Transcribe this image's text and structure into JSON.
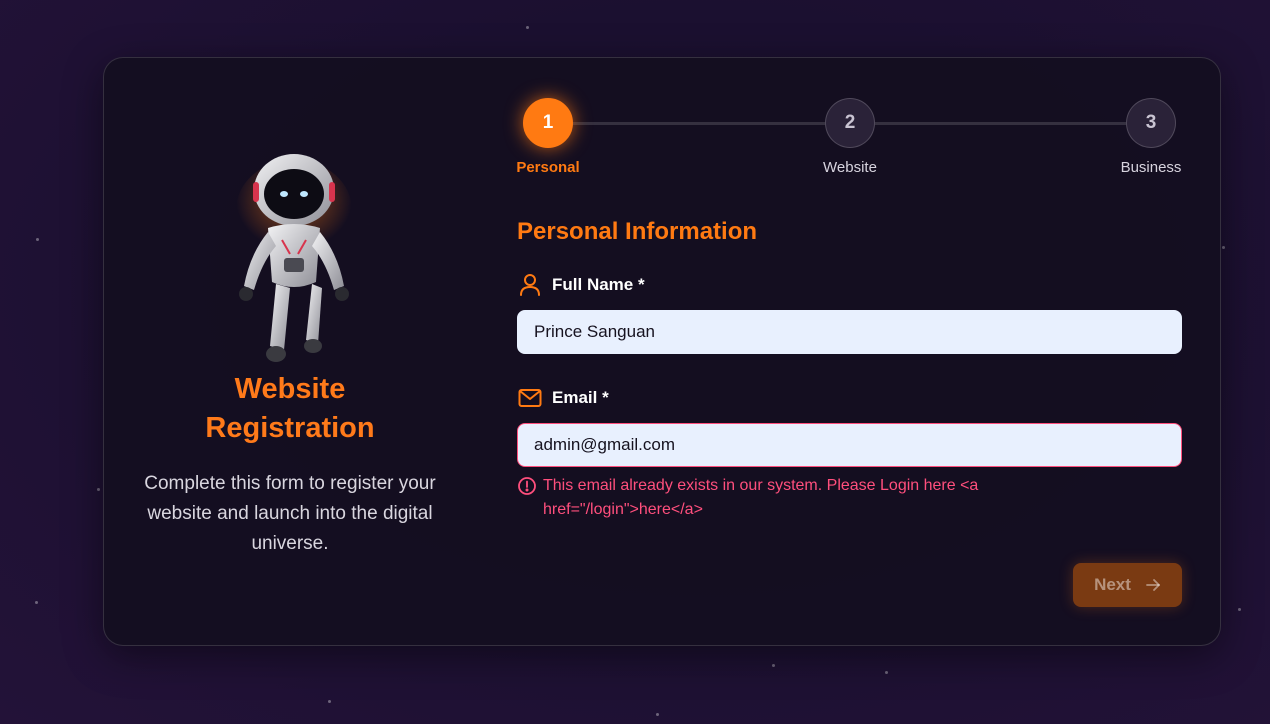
{
  "left_panel": {
    "title": "Website\nRegistration",
    "description": "Complete this form to register your website and launch into the digital universe."
  },
  "stepper": {
    "steps": [
      {
        "number": "1",
        "label": "Personal",
        "active": true
      },
      {
        "number": "2",
        "label": "Website",
        "active": false
      },
      {
        "number": "3",
        "label": "Business",
        "active": false
      }
    ]
  },
  "form": {
    "section_title": "Personal Information",
    "full_name": {
      "label": "Full Name *",
      "value": "Prince Sanguan",
      "icon": "user-icon"
    },
    "email": {
      "label": "Email *",
      "value": "admin@gmail.com",
      "icon": "mail-icon",
      "error": "This email already exists in our system. Please Login here <a href=\"/login\">here</a>"
    },
    "next_label": "Next"
  },
  "colors": {
    "accent": "#ff7a12",
    "error": "#ff4f7d",
    "input_bg": "#e8f0fe"
  }
}
